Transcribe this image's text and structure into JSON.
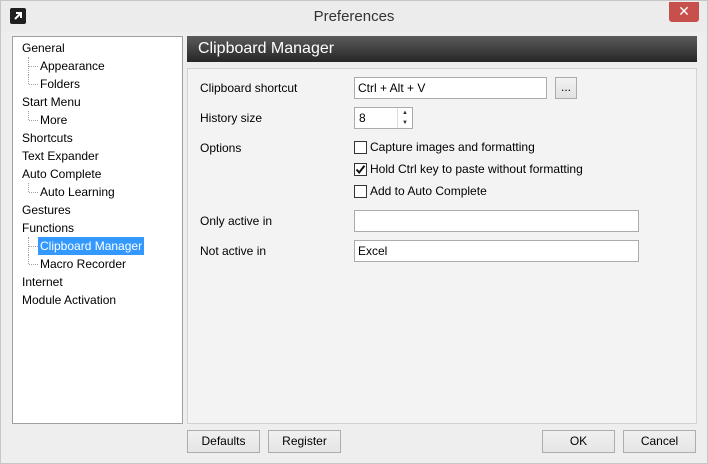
{
  "window": {
    "title": "Preferences",
    "close_glyph": "✕"
  },
  "sidebar": {
    "items": [
      {
        "label": "General",
        "level": 0
      },
      {
        "label": "Appearance",
        "level": 1
      },
      {
        "label": "Folders",
        "level": 1
      },
      {
        "label": "Start Menu",
        "level": 0
      },
      {
        "label": "More",
        "level": 1
      },
      {
        "label": "Shortcuts",
        "level": 0
      },
      {
        "label": "Text Expander",
        "level": 0
      },
      {
        "label": "Auto Complete",
        "level": 0
      },
      {
        "label": "Auto Learning",
        "level": 1
      },
      {
        "label": "Gestures",
        "level": 0
      },
      {
        "label": "Functions",
        "level": 0
      },
      {
        "label": "Clipboard Manager",
        "level": 1,
        "selected": true
      },
      {
        "label": "Macro Recorder",
        "level": 1
      },
      {
        "label": "Internet",
        "level": 0
      },
      {
        "label": "Module Activation",
        "level": 0
      }
    ]
  },
  "panel": {
    "title": "Clipboard Manager",
    "shortcut_label": "Clipboard shortcut",
    "shortcut_value": "Ctrl + Alt + V",
    "browse_label": "...",
    "history_label": "History size",
    "history_value": "8",
    "options_label": "Options",
    "options": [
      {
        "label": "Capture images and formatting",
        "checked": false
      },
      {
        "label": "Hold Ctrl key to paste without formatting",
        "checked": true
      },
      {
        "label": "Add to Auto Complete",
        "checked": false
      }
    ],
    "only_active_label": "Only active in",
    "only_active_value": "",
    "not_active_label": "Not active in",
    "not_active_value": "Excel"
  },
  "buttons": {
    "defaults": "Defaults",
    "register": "Register",
    "ok": "OK",
    "cancel": "Cancel"
  },
  "colors": {
    "selection": "#3399ff",
    "header_bg": "#3a3a3a",
    "close_button": "#c7504d"
  }
}
